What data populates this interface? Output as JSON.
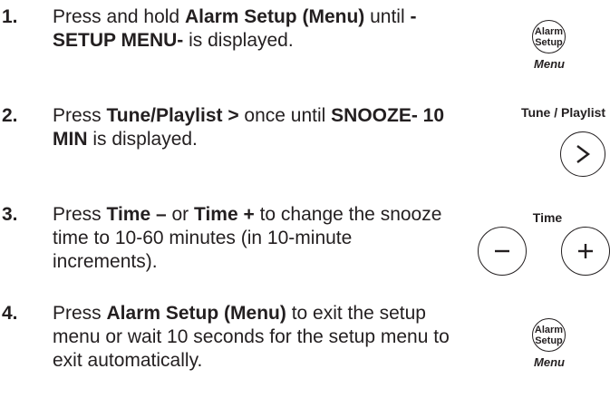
{
  "steps": [
    {
      "number": "1.",
      "parts": [
        {
          "text": "Press and hold ",
          "bold": false
        },
        {
          "text": "Alarm Setup (Menu)",
          "bold": true
        },
        {
          "text": " until ",
          "bold": false
        },
        {
          "text": "-SETUP MENU-",
          "bold": true
        },
        {
          "text": " is displayed.",
          "bold": false
        }
      ]
    },
    {
      "number": "2.",
      "parts": [
        {
          "text": "Press ",
          "bold": false
        },
        {
          "text": "Tune/Playlist >",
          "bold": true
        },
        {
          "text": " once until ",
          "bold": false
        },
        {
          "text": "SNOOZE- 10 MIN",
          "bold": true
        },
        {
          "text": " is displayed.",
          "bold": false
        }
      ]
    },
    {
      "number": "3.",
      "parts": [
        {
          "text": "Press ",
          "bold": false
        },
        {
          "text": "Time –",
          "bold": true
        },
        {
          "text": " or ",
          "bold": false
        },
        {
          "text": "Time +",
          "bold": true
        },
        {
          "text": " to change the snooze time to 10-60 minutes (in 10-minute increments).",
          "bold": false
        }
      ]
    },
    {
      "number": "4.",
      "parts": [
        {
          "text": "Press ",
          "bold": false
        },
        {
          "text": "Alarm Setup (Menu)",
          "bold": true
        },
        {
          "text": " to exit the setup menu or wait 10 seconds for the setup menu to exit automatically.",
          "bold": false
        }
      ]
    }
  ],
  "controls": {
    "alarm_setup_1": {
      "line1": "Alarm",
      "line2": "Setup",
      "caption": "Menu"
    },
    "tune_playlist": {
      "caption": "Tune / Playlist",
      "symbol": ">"
    },
    "time": {
      "caption": "Time",
      "minus": "−",
      "plus": "+"
    },
    "alarm_setup_2": {
      "line1": "Alarm",
      "line2": "Setup",
      "caption": "Menu"
    }
  }
}
